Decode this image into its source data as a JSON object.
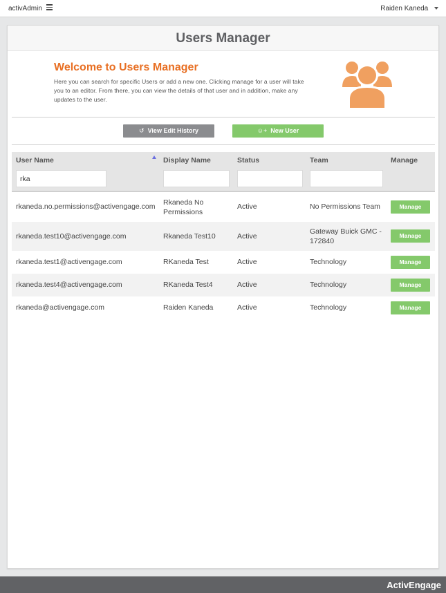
{
  "topbar": {
    "brand": "activAdmin",
    "user_name": "Raiden Kaneda"
  },
  "page": {
    "title": "Users Manager"
  },
  "welcome": {
    "heading": "Welcome to Users Manager",
    "line1": "Here you can search for specific Users or add a new one. Clicking manage for a user will take",
    "line2": "you to an editor. From there, you can view the details of that user and in addition, make any",
    "line3": "updates to the user.",
    "icon": "users-group-icon",
    "icon_color": "#f0a060"
  },
  "actions": {
    "history_label": "View Edit History",
    "new_user_label": "New User",
    "history_color": "#8b8c8f",
    "new_user_color": "#84c96b"
  },
  "table": {
    "headers": {
      "user_name": "User Name",
      "display_name": "Display Name",
      "status": "Status",
      "team": "Team",
      "manage": "Manage"
    },
    "filters": {
      "user_name": "rka",
      "display_name": "",
      "status": "",
      "team": ""
    },
    "manage_label": "Manage",
    "rows": [
      {
        "user_name": "rkaneda.no.permissions@activengage.com",
        "display_name_l1": "Rkaneda No",
        "display_name_l2": "Permissions",
        "status": "Active",
        "team_l1": "No Permissions Team",
        "team_l2": ""
      },
      {
        "user_name": "rkaneda.test10@activengage.com",
        "display_name_l1": "Rkaneda Test10",
        "display_name_l2": "",
        "status": "Active",
        "team_l1": "Gateway Buick GMC -",
        "team_l2": "172840"
      },
      {
        "user_name": "rkaneda.test1@activengage.com",
        "display_name_l1": "RKaneda Test",
        "display_name_l2": "",
        "status": "Active",
        "team_l1": "Technology",
        "team_l2": ""
      },
      {
        "user_name": "rkaneda.test4@activengage.com",
        "display_name_l1": "RKaneda Test4",
        "display_name_l2": "",
        "status": "Active",
        "team_l1": "Technology",
        "team_l2": ""
      },
      {
        "user_name": "rkaneda@activengage.com",
        "display_name_l1": "Raiden Kaneda",
        "display_name_l2": "",
        "status": "Active",
        "team_l1": "Technology",
        "team_l2": ""
      }
    ]
  },
  "footer": {
    "brand": "ActivEngage"
  },
  "colors": {
    "accent_orange": "#e86f23",
    "button_green": "#84c96b",
    "footer_bg": "#616265"
  }
}
